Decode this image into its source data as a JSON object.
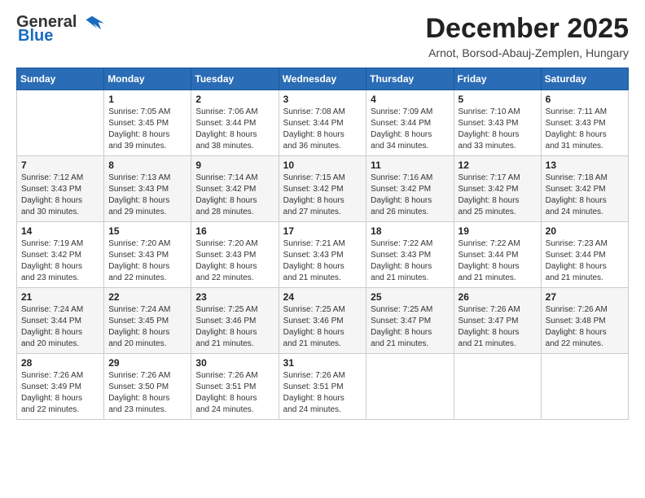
{
  "logo": {
    "general": "General",
    "blue": "Blue"
  },
  "title": "December 2025",
  "location": "Arnot, Borsod-Abauj-Zemplen, Hungary",
  "days_of_week": [
    "Sunday",
    "Monday",
    "Tuesday",
    "Wednesday",
    "Thursday",
    "Friday",
    "Saturday"
  ],
  "weeks": [
    [
      {
        "day": "",
        "info": ""
      },
      {
        "day": "1",
        "info": "Sunrise: 7:05 AM\nSunset: 3:45 PM\nDaylight: 8 hours\nand 39 minutes."
      },
      {
        "day": "2",
        "info": "Sunrise: 7:06 AM\nSunset: 3:44 PM\nDaylight: 8 hours\nand 38 minutes."
      },
      {
        "day": "3",
        "info": "Sunrise: 7:08 AM\nSunset: 3:44 PM\nDaylight: 8 hours\nand 36 minutes."
      },
      {
        "day": "4",
        "info": "Sunrise: 7:09 AM\nSunset: 3:44 PM\nDaylight: 8 hours\nand 34 minutes."
      },
      {
        "day": "5",
        "info": "Sunrise: 7:10 AM\nSunset: 3:43 PM\nDaylight: 8 hours\nand 33 minutes."
      },
      {
        "day": "6",
        "info": "Sunrise: 7:11 AM\nSunset: 3:43 PM\nDaylight: 8 hours\nand 31 minutes."
      }
    ],
    [
      {
        "day": "7",
        "info": "Sunrise: 7:12 AM\nSunset: 3:43 PM\nDaylight: 8 hours\nand 30 minutes."
      },
      {
        "day": "8",
        "info": "Sunrise: 7:13 AM\nSunset: 3:43 PM\nDaylight: 8 hours\nand 29 minutes."
      },
      {
        "day": "9",
        "info": "Sunrise: 7:14 AM\nSunset: 3:42 PM\nDaylight: 8 hours\nand 28 minutes."
      },
      {
        "day": "10",
        "info": "Sunrise: 7:15 AM\nSunset: 3:42 PM\nDaylight: 8 hours\nand 27 minutes."
      },
      {
        "day": "11",
        "info": "Sunrise: 7:16 AM\nSunset: 3:42 PM\nDaylight: 8 hours\nand 26 minutes."
      },
      {
        "day": "12",
        "info": "Sunrise: 7:17 AM\nSunset: 3:42 PM\nDaylight: 8 hours\nand 25 minutes."
      },
      {
        "day": "13",
        "info": "Sunrise: 7:18 AM\nSunset: 3:42 PM\nDaylight: 8 hours\nand 24 minutes."
      }
    ],
    [
      {
        "day": "14",
        "info": "Sunrise: 7:19 AM\nSunset: 3:42 PM\nDaylight: 8 hours\nand 23 minutes."
      },
      {
        "day": "15",
        "info": "Sunrise: 7:20 AM\nSunset: 3:43 PM\nDaylight: 8 hours\nand 22 minutes."
      },
      {
        "day": "16",
        "info": "Sunrise: 7:20 AM\nSunset: 3:43 PM\nDaylight: 8 hours\nand 22 minutes."
      },
      {
        "day": "17",
        "info": "Sunrise: 7:21 AM\nSunset: 3:43 PM\nDaylight: 8 hours\nand 21 minutes."
      },
      {
        "day": "18",
        "info": "Sunrise: 7:22 AM\nSunset: 3:43 PM\nDaylight: 8 hours\nand 21 minutes."
      },
      {
        "day": "19",
        "info": "Sunrise: 7:22 AM\nSunset: 3:44 PM\nDaylight: 8 hours\nand 21 minutes."
      },
      {
        "day": "20",
        "info": "Sunrise: 7:23 AM\nSunset: 3:44 PM\nDaylight: 8 hours\nand 21 minutes."
      }
    ],
    [
      {
        "day": "21",
        "info": "Sunrise: 7:24 AM\nSunset: 3:44 PM\nDaylight: 8 hours\nand 20 minutes."
      },
      {
        "day": "22",
        "info": "Sunrise: 7:24 AM\nSunset: 3:45 PM\nDaylight: 8 hours\nand 20 minutes."
      },
      {
        "day": "23",
        "info": "Sunrise: 7:25 AM\nSunset: 3:46 PM\nDaylight: 8 hours\nand 21 minutes."
      },
      {
        "day": "24",
        "info": "Sunrise: 7:25 AM\nSunset: 3:46 PM\nDaylight: 8 hours\nand 21 minutes."
      },
      {
        "day": "25",
        "info": "Sunrise: 7:25 AM\nSunset: 3:47 PM\nDaylight: 8 hours\nand 21 minutes."
      },
      {
        "day": "26",
        "info": "Sunrise: 7:26 AM\nSunset: 3:47 PM\nDaylight: 8 hours\nand 21 minutes."
      },
      {
        "day": "27",
        "info": "Sunrise: 7:26 AM\nSunset: 3:48 PM\nDaylight: 8 hours\nand 22 minutes."
      }
    ],
    [
      {
        "day": "28",
        "info": "Sunrise: 7:26 AM\nSunset: 3:49 PM\nDaylight: 8 hours\nand 22 minutes."
      },
      {
        "day": "29",
        "info": "Sunrise: 7:26 AM\nSunset: 3:50 PM\nDaylight: 8 hours\nand 23 minutes."
      },
      {
        "day": "30",
        "info": "Sunrise: 7:26 AM\nSunset: 3:51 PM\nDaylight: 8 hours\nand 24 minutes."
      },
      {
        "day": "31",
        "info": "Sunrise: 7:26 AM\nSunset: 3:51 PM\nDaylight: 8 hours\nand 24 minutes."
      },
      {
        "day": "",
        "info": ""
      },
      {
        "day": "",
        "info": ""
      },
      {
        "day": "",
        "info": ""
      }
    ]
  ]
}
